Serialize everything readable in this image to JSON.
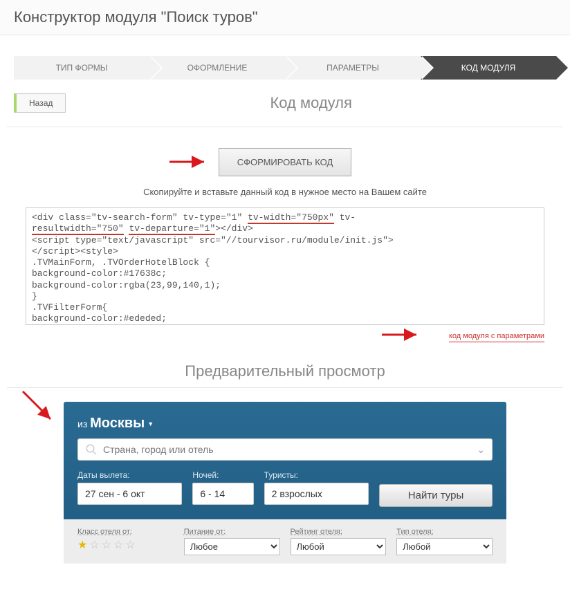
{
  "header": {
    "title": "Конструктор модуля \"Поиск туров\""
  },
  "steps": {
    "s1": "ТИП ФОРМЫ",
    "s2": "ОФОРМЛЕНИЕ",
    "s3": "ПАРАМЕТРЫ",
    "s4": "КОД МОДУЛЯ"
  },
  "back": {
    "label": "Назад"
  },
  "section1": {
    "title": "Код модуля"
  },
  "generate": {
    "label": "СФОРМИРОВАТЬ КОД"
  },
  "instructions": "Скопируйте и вставьте данный код в нужное место на Вашем сайте",
  "code": {
    "l1a": "<div class=\"tv-search-form\" tv-type=\"1\" ",
    "l1b": "tv-width=\"750px\"",
    "l1c": " tv-",
    "l2a": "resultwidth=\"750\"",
    "l2b": " ",
    "l2c": "tv-departure=\"1\"",
    "l2d": "></div>",
    "l3": "<script type=\"text/javascript\" src=\"//tourvisor.ru/module/init.js\">",
    "l4": "</script><style>",
    "l5": ".TVMainForm, .TVOrderHotelBlock {",
    "l6": "background-color:#17638c;",
    "l7": "background-color:rgba(23,99,140,1);",
    "l8": "}",
    "l9": ".TVFilterForm{",
    "l10": "background-color:#ededed;"
  },
  "params_link": "код модуля с параметрами",
  "section2": {
    "title": "Предварительный просмотр"
  },
  "tv": {
    "from_prefix": "из ",
    "from_city": "Москвы",
    "search_placeholder": "Страна, город или отель",
    "dates_label": "Даты вылета:",
    "dates_value": "27 сен - 6 окт",
    "nights_label": "Ночей:",
    "nights_value": "6 - 14",
    "tourists_label": "Туристы:",
    "tourists_value": "2 взрослых",
    "find": "Найти туры",
    "class_label": "Класс отеля от:",
    "meal_label": "Питание от:",
    "meal_value": "Любое",
    "rating_label": "Рейтинг отеля:",
    "rating_value": "Любой",
    "type_label": "Тип отеля:",
    "type_value": "Любой"
  }
}
